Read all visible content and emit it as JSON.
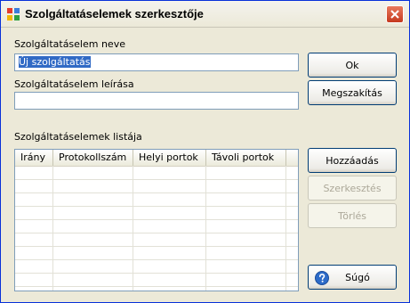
{
  "window": {
    "title": "Szolgáltatáselemek szerkesztője"
  },
  "form": {
    "name_label": "Szolgáltatáselem neve",
    "name_value": "Új szolgáltatás",
    "desc_label": "Szolgáltatáselem leírása",
    "desc_value": "",
    "list_label": "Szolgáltatáselemek listája"
  },
  "list": {
    "columns": [
      "Irány",
      "Protokollszám",
      "Helyi portok",
      "Távoli portok"
    ],
    "rows": []
  },
  "buttons": {
    "ok": "Ok",
    "cancel": "Megszakítás",
    "add": "Hozzáadás",
    "edit": "Szerkesztés",
    "delete": "Törlés",
    "help": "Súgó"
  },
  "colors": {
    "accent": "#316ac5",
    "border": "#003c74",
    "close": "#c5391e"
  }
}
